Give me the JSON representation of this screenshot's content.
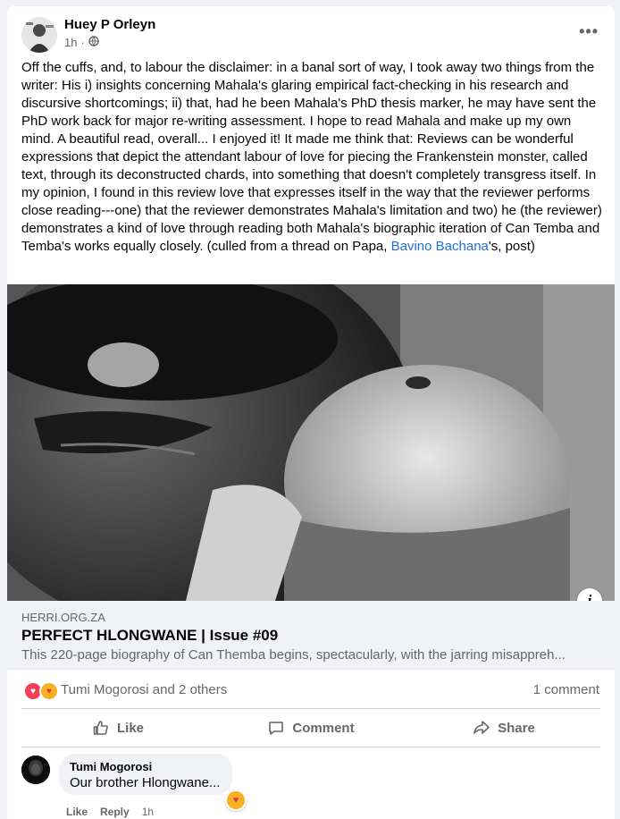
{
  "post": {
    "author": "Huey P Orleyn",
    "time": "1h",
    "separator": "·",
    "more_label": "•••",
    "text_main": "Off the cuffs, and, to labour the disclaimer: in a banal sort of way, I took away two things from the writer: His i) insights concerning Mahala's glaring empirical fact-checking in his research and discursive shortcomings; ii) that, had he been Mahala's PhD thesis marker,  he may have sent the PhD work back for major re-writing assessment. I hope to read Mahala and make up my own mind. A beautiful read, overall... I enjoyed it! It made me think that: Reviews can be wonderful expressions that depict the attendant labour of love for piecing the Frankenstein monster, called text, through its deconstructed chards, into something that doesn't completely transgress itself. In my opinion, I found in this review love that expresses itself in the way that the reviewer performs close reading---one) that the reviewer demonstrates Mahala's limitation and two) he (the reviewer) demonstrates a kind of love through reading both Mahala's biographic iteration of Can Temba and Temba's works equally closely. (culled from a thread on Papa, ",
    "mention": "Bavino Bachana",
    "text_tail": "'s, post)"
  },
  "link": {
    "info_label": "i",
    "domain": "HERRI.ORG.ZA",
    "title": "PERFECT HLONGWANE | Issue #09",
    "description": "This 220-page biography of Can Themba begins, spectacularly, with the jarring misappreh..."
  },
  "stats": {
    "reactors": "Tumi Mogorosi and 2 others",
    "comments": "1 comment",
    "reaction_icons": [
      "love-icon",
      "care-icon"
    ]
  },
  "actions": {
    "like": "Like",
    "comment": "Comment",
    "share": "Share"
  },
  "comment": {
    "author": "Tumi Mogorosi",
    "text": "Our brother Hlongwane...",
    "like": "Like",
    "reply": "Reply",
    "time": "1h",
    "reaction_icon": "care-icon"
  },
  "colors": {
    "link": "#216fdb",
    "secondary_text": "#65676b",
    "love": "#f33e58",
    "care": "#f7b125"
  }
}
